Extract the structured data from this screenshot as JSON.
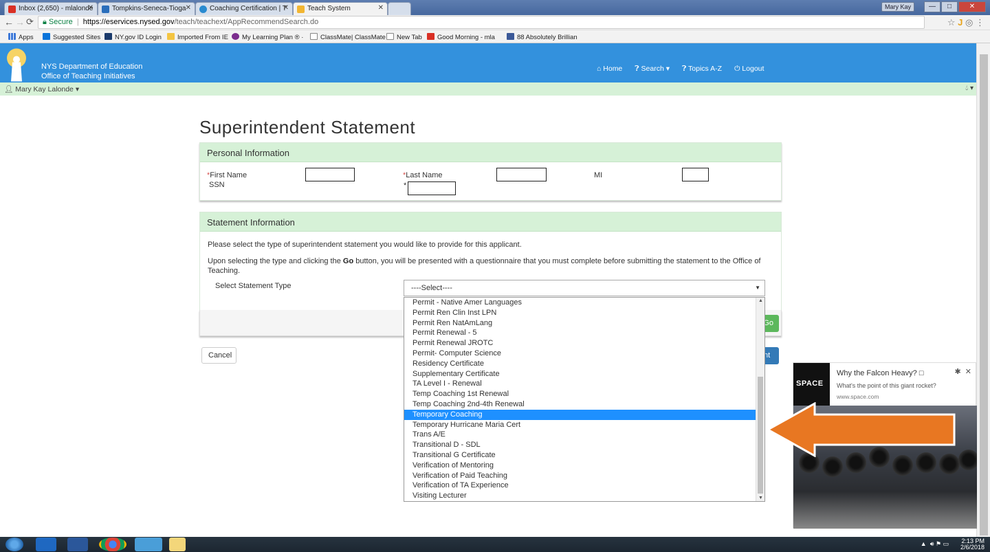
{
  "browser": {
    "tabs": [
      {
        "title": "Inbox (2,650) - mlalonde",
        "favicon_color": "#d93025"
      },
      {
        "title": "Tompkins-Seneca-Tioga",
        "favicon_color": "#2a6ebb"
      },
      {
        "title": "Coaching Certification | T",
        "favicon_color": "#2a8bd0"
      },
      {
        "title": "Teach System",
        "favicon_color": "#f2b632",
        "active": true
      }
    ],
    "user_chip": "Mary Kay",
    "secure_label": "Secure",
    "url_host": "https://eservices.nysed.gov",
    "url_path": "/teach/teachext/AppRecommendSearch.do",
    "bookmarks": [
      "Apps",
      "Suggested Sites",
      "NY.gov ID Login",
      "Imported From IE",
      "My Learning Plan ® ·",
      "ClassMate| ClassMate",
      "New Tab",
      "Good Morning - mla",
      "88 Absolutely Brillian"
    ]
  },
  "header": {
    "org_line1": "NYS Department of Education",
    "org_line2": "Office of Teaching Initiatives",
    "nav": [
      "Home",
      "Search",
      "Topics A-Z",
      "Logout"
    ],
    "user": "Mary Kay Lalonde"
  },
  "page": {
    "title": "Superintendent Statement",
    "personal": {
      "heading": "Personal Information",
      "first_name": "First Name",
      "last_name": "Last Name",
      "mi": "MI",
      "ssn": "SSN",
      "required_mark": "*"
    },
    "statement": {
      "heading": "Statement Information",
      "intro": "Please select the type of superintendent statement you would like to provide for this applicant.",
      "instructions_pre": "Upon selecting the type and clicking the ",
      "instructions_go": "Go",
      "instructions_post": " button, you will be presented with a questionnaire that you must complete before submitting the statement to the Office of Teaching.",
      "select_label": "Select Statement Type",
      "select_value": "----Select----"
    },
    "go_label": "Go",
    "cancel_label": "Cancel",
    "submit_label": "nt",
    "dropdown_options": [
      "Permit - Native Amer Languages",
      "Permit Ren Clin Inst LPN",
      "Permit Ren NatAmLang",
      "Permit Renewal - 5",
      "Permit Renewal JROTC",
      "Permit- Computer Science",
      "Residency Certificate",
      "Supplementary Certificate",
      "TA Level I - Renewal",
      "Temp Coaching 1st Renewal",
      "Temp Coaching 2nd-4th Renewal",
      "Temporary Coaching",
      "Temporary Hurricane Maria Cert",
      "Trans A/E",
      "Transitional D - SDL",
      "Transitional G Certificate",
      "Verification of Mentoring",
      "Verification of Paid Teaching",
      "Verification of TA Experience",
      "Visiting Lecturer"
    ],
    "selected_option": "Temporary Coaching"
  },
  "ad": {
    "logo": "SPACE",
    "title": "Why the Falcon Heavy? □",
    "subtitle": "What's the point of this giant rocket?",
    "url": "www.space.com",
    "arrow_color": "#e87722"
  },
  "taskbar": {
    "time": "2:13 PM",
    "date": "2/6/2018"
  }
}
